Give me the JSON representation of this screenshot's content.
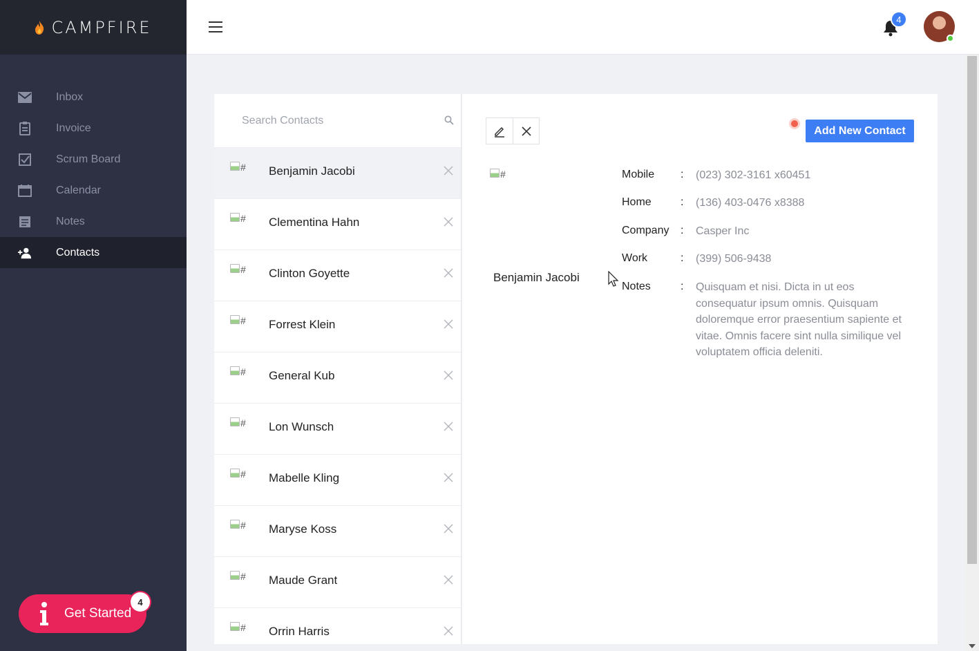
{
  "brand": {
    "name": "CAMPFIRE"
  },
  "sidebar": {
    "items": [
      {
        "label": "Inbox",
        "icon": "mail-icon",
        "active": false
      },
      {
        "label": "Invoice",
        "icon": "clipboard-icon",
        "active": false
      },
      {
        "label": "Scrum Board",
        "icon": "checkbox-icon",
        "active": false
      },
      {
        "label": "Calendar",
        "icon": "calendar-icon",
        "active": false
      },
      {
        "label": "Notes",
        "icon": "notebook-icon",
        "active": false
      },
      {
        "label": "Contacts",
        "icon": "add-user-icon",
        "active": true
      }
    ],
    "get_started": {
      "label": "Get Started",
      "badge": "4"
    }
  },
  "topbar": {
    "notification_count": "4"
  },
  "contacts": {
    "search_placeholder": "Search Contacts",
    "image_alt": "#",
    "list": [
      "Benjamin Jacobi",
      "Clementina Hahn",
      "Clinton Goyette",
      "Forrest Klein",
      "General Kub",
      "Lon Wunsch",
      "Mabelle Kling",
      "Maryse Koss",
      "Maude Grant",
      "Orrin Harris"
    ],
    "selected": "Benjamin Jacobi"
  },
  "detail": {
    "add_button": "Add New Contact",
    "name": "Benjamin Jacobi",
    "image_alt": "#",
    "colon": ":",
    "fields": [
      {
        "label": "Mobile",
        "value": "(023) 302-3161 x60451"
      },
      {
        "label": "Home",
        "value": "(136) 403-0476 x8388"
      },
      {
        "label": "Company",
        "value": "Casper Inc"
      },
      {
        "label": "Work",
        "value": "(399) 506-9438"
      },
      {
        "label": "Notes",
        "value": "Quisquam et nisi. Dicta in ut eos consequatur ipsum omnis. Quisquam doloremque error praesentium sapiente et vitae. Omnis facere sint nulla similique vel voluptatem officia deleniti."
      }
    ]
  },
  "colors": {
    "sidebar_bg": "#2e3144",
    "brand_bg": "#23252f",
    "accent_blue": "#3d7ef5",
    "get_started_pink": "#e9245a",
    "pulse_red": "#f2614e"
  }
}
